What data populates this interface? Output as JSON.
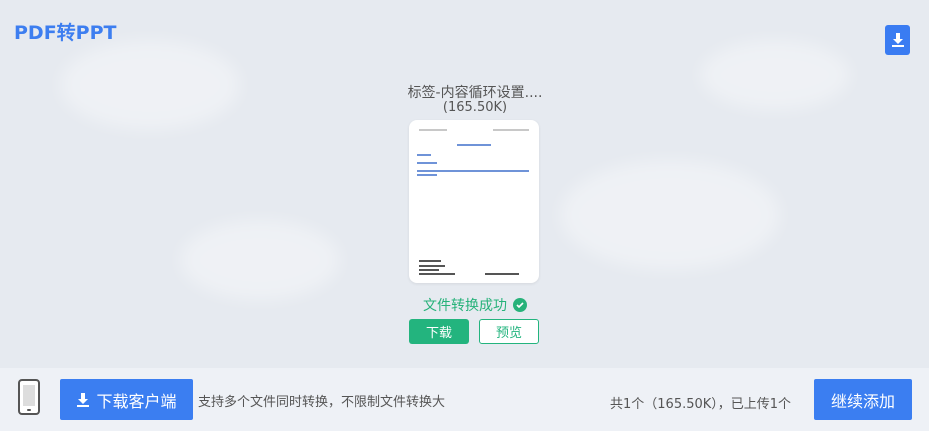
{
  "header": {
    "title": "PDF转PPT"
  },
  "file": {
    "name": "标签-内容循环设置....",
    "size": "(165.50K)"
  },
  "result": {
    "status_text": "文件转换成功",
    "download_label": "下载",
    "preview_label": "预览"
  },
  "footer": {
    "client_button_label": "下载客户端",
    "support_text": "支持多个文件同时转换，不限制文件转换大",
    "count_text": "共1个（165.50K），已上传1个",
    "add_button_label": "继续添加"
  },
  "colors": {
    "accent_blue": "#3b7ef1",
    "success_green": "#23b47e"
  }
}
